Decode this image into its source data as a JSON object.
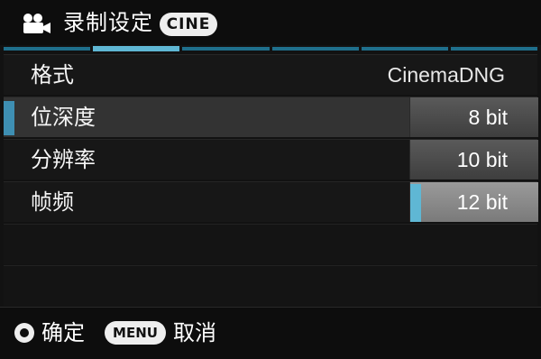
{
  "header": {
    "icon": "movie-camera-icon",
    "title": "录制设定",
    "badge": "CINE"
  },
  "tabs": {
    "count": 6,
    "active_index": 1,
    "colors": {
      "inactive": "#1f6f8c",
      "active": "#5fb7d4"
    }
  },
  "settings": [
    {
      "label": "格式",
      "value": "CinemaDNG"
    },
    {
      "label": "位深度",
      "selected": true
    },
    {
      "label": "分辨率"
    },
    {
      "label": "帧频"
    }
  ],
  "options": [
    {
      "label": "8 bit",
      "highlighted": false
    },
    {
      "label": "10 bit",
      "highlighted": false
    },
    {
      "label": "12 bit",
      "highlighted": true
    }
  ],
  "footer": {
    "ok_icon": "ok-circle-icon",
    "ok_label": "确定",
    "menu_badge": "MENU",
    "cancel_label": "取消"
  }
}
